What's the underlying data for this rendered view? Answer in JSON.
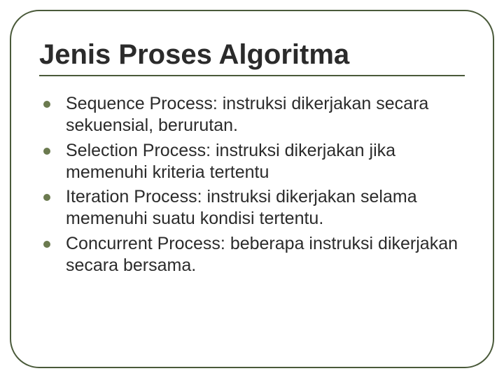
{
  "title": "Jenis Proses Algoritma",
  "bullets": [
    "Sequence Process: instruksi dikerjakan secara sekuensial, berurutan.",
    "Selection Process: instruksi dikerjakan jika memenuhi kriteria tertentu",
    "Iteration Process: instruksi dikerjakan selama memenuhi suatu kondisi tertentu.",
    "Concurrent Process: beberapa instruksi dikerjakan secara bersama."
  ]
}
